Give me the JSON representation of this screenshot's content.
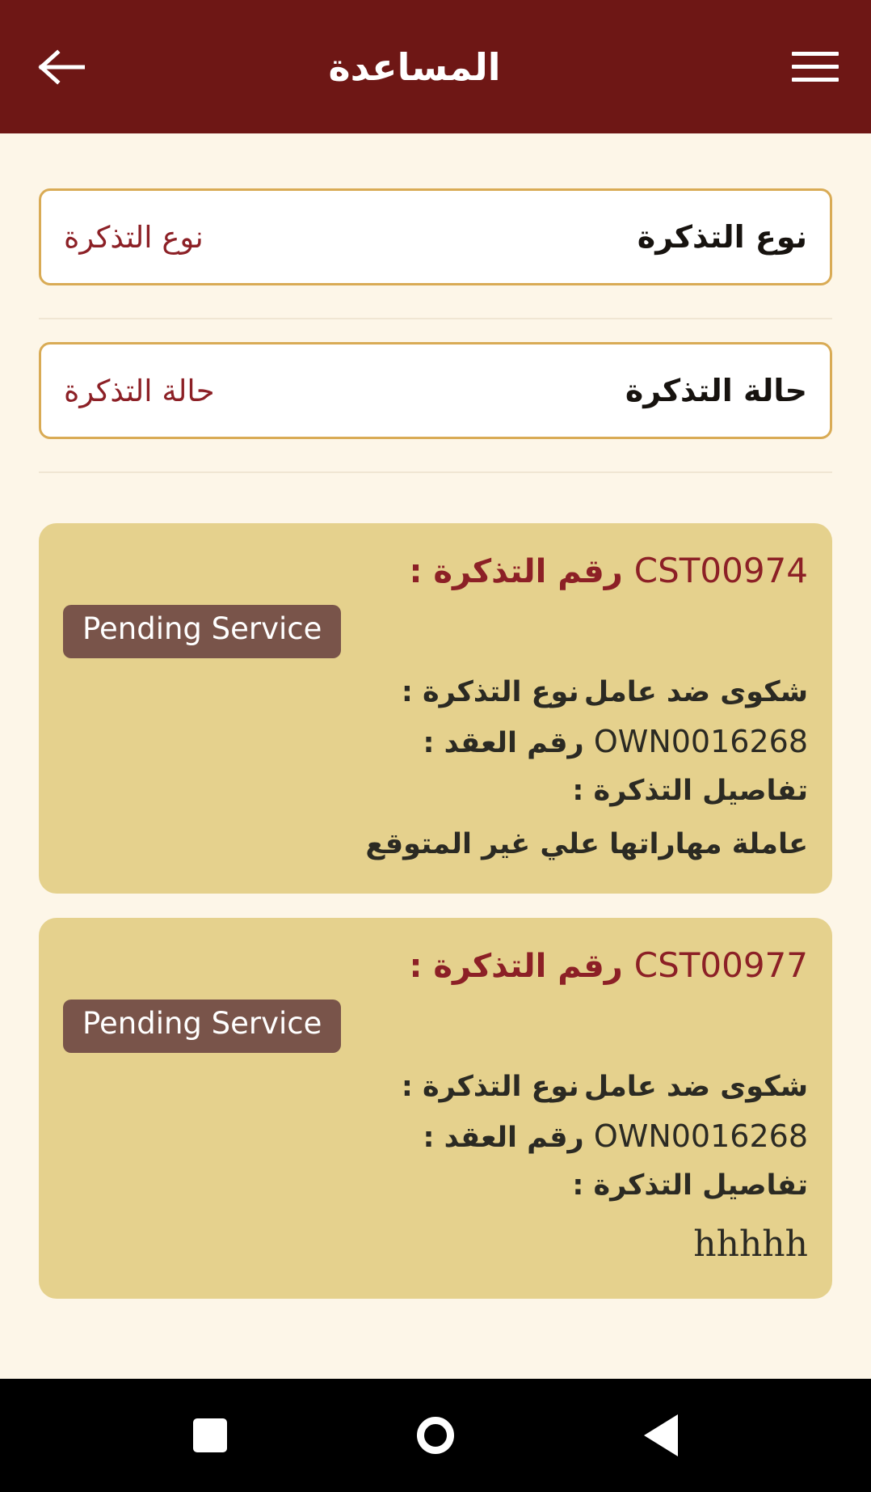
{
  "appbar": {
    "title": "المساعدة",
    "back_icon": "arrow-left-icon",
    "menu_icon": "hamburger-menu-icon"
  },
  "filters": [
    {
      "name": "ticket-type",
      "label": "نوع التذكرة",
      "value": "نوع التذكرة"
    },
    {
      "name": "ticket-status",
      "label": "حالة التذكرة",
      "value": "حالة التذكرة"
    }
  ],
  "labels": {
    "ticket_number": "رقم التذكرة :",
    "ticket_type": "نوع التذكرة :",
    "contract_number": "رقم العقد :",
    "ticket_details": "تفاصيل التذكرة :"
  },
  "tickets": [
    {
      "ticket_number": "CST00974",
      "status": "Pending Service",
      "ticket_type": "شكوى ضد عامل",
      "contract_number": "OWN0016268",
      "details": "عاملة مهاراتها علي غير المتوقع",
      "details_is_latin": false
    },
    {
      "ticket_number": "CST00977",
      "status": "Pending Service",
      "ticket_type": "شكوى ضد عامل",
      "contract_number": "OWN0016268",
      "details": "hhhhh",
      "details_is_latin": true
    }
  ],
  "navbar": {
    "back": "back-triangle-icon",
    "home": "home-circle-icon",
    "recents": "recents-square-icon"
  },
  "colors": {
    "appbar_bg": "#6e1715",
    "page_bg": "#fdf6e8",
    "card_bg": "#e5d18d",
    "badge_bg": "#79544a",
    "accent_border": "#d9ab55",
    "accent_red": "#8c2026"
  }
}
